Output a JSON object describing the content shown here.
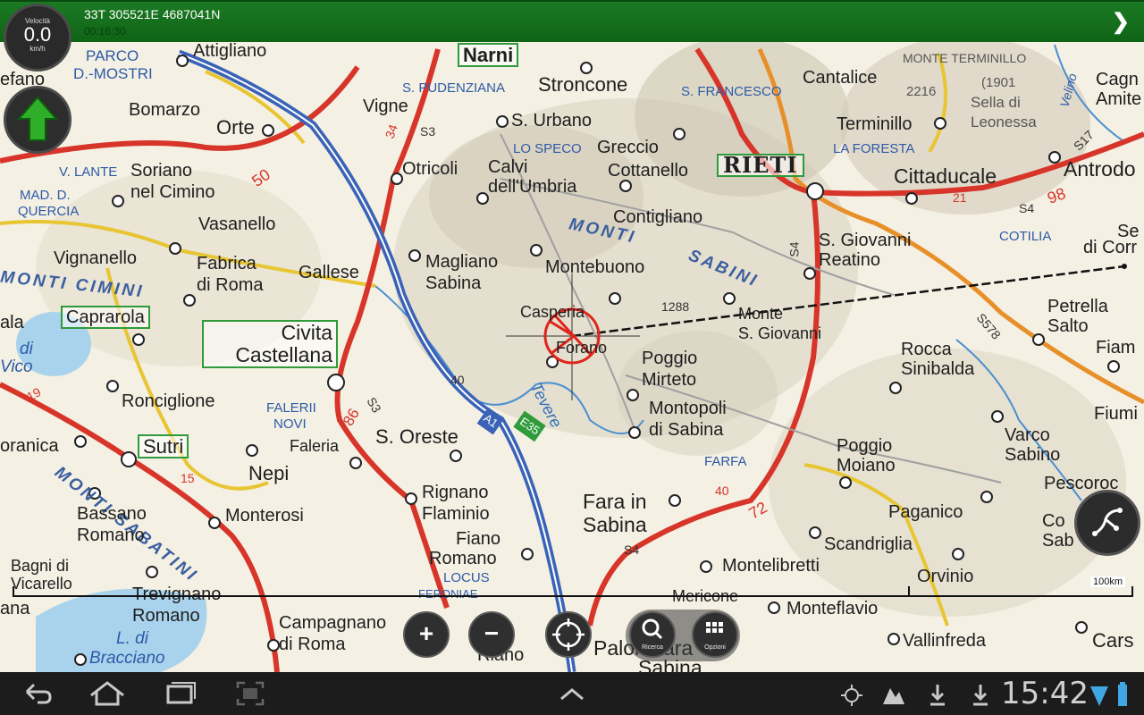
{
  "header": {
    "coordinates": "33T 305521E 4687041N",
    "elapsed": "00:16:30",
    "next_icon": "chevron-right-icon"
  },
  "speedometer": {
    "title": "Velocità",
    "value": "0.0",
    "unit": "km/h"
  },
  "compass": {
    "icon": "north-arrow-icon"
  },
  "map": {
    "scale_label": "100km",
    "places": [
      {
        "id": "attigliano",
        "text": "Attigliano"
      },
      {
        "id": "narni",
        "text": "Narni"
      },
      {
        "id": "stroncone",
        "text": "Stroncone"
      },
      {
        "id": "cantalice",
        "text": "Cantalice"
      },
      {
        "id": "monte-terminillo",
        "text": "MONTE TERMINILLO"
      },
      {
        "id": "terminillo-elev",
        "text": "2216"
      },
      {
        "id": "sella-elev",
        "text": "(1901"
      },
      {
        "id": "sella",
        "text": "Sella di"
      },
      {
        "id": "leonessa",
        "text": "Leonessa"
      },
      {
        "id": "velino",
        "text": "Velino"
      },
      {
        "id": "cagn",
        "text": "Cagn"
      },
      {
        "id": "amite",
        "text": "Amite"
      },
      {
        "id": "parco",
        "text": "PARCO"
      },
      {
        "id": "dmostri",
        "text": "D.-MOSTRI"
      },
      {
        "id": "efano",
        "text": "efano"
      },
      {
        "id": "bomarzo",
        "text": "Bomarzo"
      },
      {
        "id": "orte",
        "text": "Orte"
      },
      {
        "id": "vigne",
        "text": "Vigne"
      },
      {
        "id": "s-pudenziana",
        "text": "S. PUDENZIANA"
      },
      {
        "id": "s-urbano",
        "text": "S. Urbano"
      },
      {
        "id": "s-francesco",
        "text": "S. FRANCESCO"
      },
      {
        "id": "terminillo",
        "text": "Terminillo"
      },
      {
        "id": "lo-speco",
        "text": "LO SPECO"
      },
      {
        "id": "greccio",
        "text": "Greccio"
      },
      {
        "id": "la-foresta",
        "text": "LA FORESTA"
      },
      {
        "id": "vlante",
        "text": "V. LANTE"
      },
      {
        "id": "soriano",
        "text": "Soriano"
      },
      {
        "id": "nel-cimino",
        "text": "nel Cimino"
      },
      {
        "id": "otricoli",
        "text": "Otricoli"
      },
      {
        "id": "calvi",
        "text": "Calvi"
      },
      {
        "id": "dellumbria",
        "text": "dell'Umbria"
      },
      {
        "id": "cottanello",
        "text": "Cottanello"
      },
      {
        "id": "rieti",
        "text": "RIETI"
      },
      {
        "id": "cittaducale",
        "text": "Cittaducale"
      },
      {
        "id": "antrodo",
        "text": "Antrodo"
      },
      {
        "id": "madd",
        "text": "MAD. D."
      },
      {
        "id": "quercia",
        "text": "QUERCIA"
      },
      {
        "id": "vasanello",
        "text": "Vasanello"
      },
      {
        "id": "contigliano",
        "text": "Contigliano"
      },
      {
        "id": "monti",
        "text": "MONTI"
      },
      {
        "id": "s-giovanni",
        "text": "S. Giovanni"
      },
      {
        "id": "reatino",
        "text": "Reatino"
      },
      {
        "id": "cotilia",
        "text": "COTILIA"
      },
      {
        "id": "se",
        "text": "Se"
      },
      {
        "id": "di-corr",
        "text": "di Corr"
      },
      {
        "id": "vignanello",
        "text": "Vignanello"
      },
      {
        "id": "fabrica",
        "text": "Fabrica"
      },
      {
        "id": "di-roma",
        "text": "di Roma"
      },
      {
        "id": "gallese",
        "text": "Gallese"
      },
      {
        "id": "magliano",
        "text": "Magliano"
      },
      {
        "id": "sabina",
        "text": "Sabina"
      },
      {
        "id": "montebuono",
        "text": "Montebuono"
      },
      {
        "id": "sabini",
        "text": "SABINI"
      },
      {
        "id": "monti-cimini",
        "text": "MONTI CIMINI"
      },
      {
        "id": "casperia",
        "text": "Casperia"
      },
      {
        "id": "elev-1288",
        "text": "1288"
      },
      {
        "id": "monte-sg",
        "text": "Monte"
      },
      {
        "id": "s-giovanni2",
        "text": "S. Giovanni"
      },
      {
        "id": "petrella",
        "text": "Petrella"
      },
      {
        "id": "salto",
        "text": "Salto"
      },
      {
        "id": "ala",
        "text": "ala"
      },
      {
        "id": "caprarola",
        "text": "Caprarola"
      },
      {
        "id": "civita",
        "text": "Civita"
      },
      {
        "id": "castellana",
        "text": "Castellana"
      },
      {
        "id": "forano",
        "text": "Forano"
      },
      {
        "id": "poggio-mirteto",
        "text": "Poggio"
      },
      {
        "id": "mirteto",
        "text": "Mirteto"
      },
      {
        "id": "rocca",
        "text": "Rocca"
      },
      {
        "id": "sinibalda",
        "text": "Sinibalda"
      },
      {
        "id": "fiam",
        "text": "Fiam"
      },
      {
        "id": "di",
        "text": "di"
      },
      {
        "id": "vico",
        "text": "Vico"
      },
      {
        "id": "ronciglione",
        "text": "Ronciglione"
      },
      {
        "id": "falerii",
        "text": "FALERII"
      },
      {
        "id": "novi",
        "text": "NOVI"
      },
      {
        "id": "tevere",
        "text": "Tevere"
      },
      {
        "id": "montopoli",
        "text": "Montopoli"
      },
      {
        "id": "di-sabina",
        "text": "di Sabina"
      },
      {
        "id": "fiumi",
        "text": "Fiumi"
      },
      {
        "id": "oranica",
        "text": "oranica"
      },
      {
        "id": "sutri",
        "text": "Sutri"
      },
      {
        "id": "faleria",
        "text": "Faleria"
      },
      {
        "id": "s-oreste",
        "text": "S. Oreste"
      },
      {
        "id": "poggio-moiano",
        "text": "Poggio"
      },
      {
        "id": "moiano",
        "text": "Moiano"
      },
      {
        "id": "varco",
        "text": "Varco"
      },
      {
        "id": "sabino",
        "text": "Sabino"
      },
      {
        "id": "monti-sabatini",
        "text": "MONTI SABATINI"
      },
      {
        "id": "nepi",
        "text": "Nepi"
      },
      {
        "id": "farfa",
        "text": "FARFA"
      },
      {
        "id": "pescoroc",
        "text": "Pescoroc"
      },
      {
        "id": "bassano",
        "text": "Bassano"
      },
      {
        "id": "romano",
        "text": "Romano"
      },
      {
        "id": "monterosi",
        "text": "Monterosi"
      },
      {
        "id": "rignano",
        "text": "Rignano"
      },
      {
        "id": "flaminio",
        "text": "Flaminio"
      },
      {
        "id": "fara",
        "text": "Fara in"
      },
      {
        "id": "fara-sabina",
        "text": "Sabina"
      },
      {
        "id": "paganico",
        "text": "Paganico"
      },
      {
        "id": "co",
        "text": "Co"
      },
      {
        "id": "sab",
        "text": "Sab"
      },
      {
        "id": "fiano",
        "text": "Fiano"
      },
      {
        "id": "fiano-romano",
        "text": "Romano"
      },
      {
        "id": "scandriglia",
        "text": "Scandriglia"
      },
      {
        "id": "bagni",
        "text": "Bagni di"
      },
      {
        "id": "vicarello",
        "text": "Vicarello"
      },
      {
        "id": "locus",
        "text": "LOCUS"
      },
      {
        "id": "feronia",
        "text": "FERONIAE"
      },
      {
        "id": "montelibretti",
        "text": "Montelibretti"
      },
      {
        "id": "orvinio",
        "text": "Orvinio"
      },
      {
        "id": "trevignano",
        "text": "Trevignano"
      },
      {
        "id": "mericone",
        "text": "Mericone"
      },
      {
        "id": "ana",
        "text": "ana"
      },
      {
        "id": "trevignano-romano",
        "text": "Romano"
      },
      {
        "id": "campagnano",
        "text": "Campagnano"
      },
      {
        "id": "campagnano-roma",
        "text": "di Roma"
      },
      {
        "id": "monteflavio",
        "text": "Monteflavio"
      },
      {
        "id": "l-di",
        "text": "L. di"
      },
      {
        "id": "bracciano",
        "text": "Bracciano"
      },
      {
        "id": "riano",
        "text": "Riano"
      },
      {
        "id": "palombara",
        "text": "Palombara"
      },
      {
        "id": "palombara-sabina",
        "text": "Sabina"
      },
      {
        "id": "vallinfreda",
        "text": "Vallinfreda"
      },
      {
        "id": "cars",
        "text": "Cars"
      }
    ],
    "roads": [
      {
        "id": "r-s3a",
        "text": "S3"
      },
      {
        "id": "r-34",
        "text": "34"
      },
      {
        "id": "r-50",
        "text": "50"
      },
      {
        "id": "r-s4a",
        "text": "S4"
      },
      {
        "id": "r-s4b",
        "text": "S4"
      },
      {
        "id": "r-21",
        "text": "21"
      },
      {
        "id": "r-98",
        "text": "98"
      },
      {
        "id": "r-s17",
        "text": "S17"
      },
      {
        "id": "r-s578",
        "text": "S578"
      },
      {
        "id": "r-19",
        "text": "19"
      },
      {
        "id": "r-40a",
        "text": "40"
      },
      {
        "id": "r-a1",
        "text": "A1"
      },
      {
        "id": "r-e35",
        "text": "E35"
      },
      {
        "id": "r-86",
        "text": "86"
      },
      {
        "id": "r-s3b",
        "text": "S3"
      },
      {
        "id": "r-15",
        "text": "15"
      },
      {
        "id": "r-40b",
        "text": "40"
      },
      {
        "id": "r-72",
        "text": "72"
      },
      {
        "id": "r-s4c",
        "text": "S4"
      }
    ]
  },
  "controls": {
    "zoom_in": "+",
    "zoom_out": "−",
    "search_caption": "Ricerca",
    "options_caption": "Opzioni"
  },
  "statusbar": {
    "time": "15:42"
  },
  "colors": {
    "header": "#147020",
    "road_primary": "#d8352a",
    "motorway": "#3a63b8",
    "route": "#111111"
  }
}
